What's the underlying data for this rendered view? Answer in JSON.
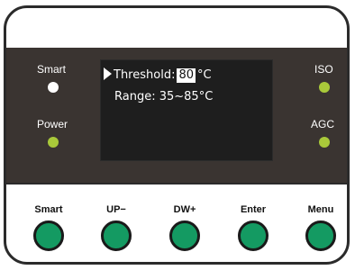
{
  "panel": {
    "left_indicators": [
      {
        "label": "Smart",
        "led_color": "#ffffff"
      },
      {
        "label": "Power",
        "led_color": "#a9c93a"
      }
    ],
    "right_indicators": [
      {
        "label": "ISO",
        "led_color": "#a9c93a"
      },
      {
        "label": "AGC",
        "led_color": "#a9c93a"
      }
    ]
  },
  "screen": {
    "threshold_label": "Threshold:",
    "threshold_value": "80",
    "threshold_unit": "°C",
    "range_text": "Range: 35~85°C"
  },
  "buttons": [
    {
      "label": "Smart",
      "color": "#149a62"
    },
    {
      "label": "UP−",
      "color": "#149a62"
    },
    {
      "label": "DW+",
      "color": "#149a62"
    },
    {
      "label": "Enter",
      "color": "#149a62"
    },
    {
      "label": "Menu",
      "color": "#149a62"
    }
  ]
}
